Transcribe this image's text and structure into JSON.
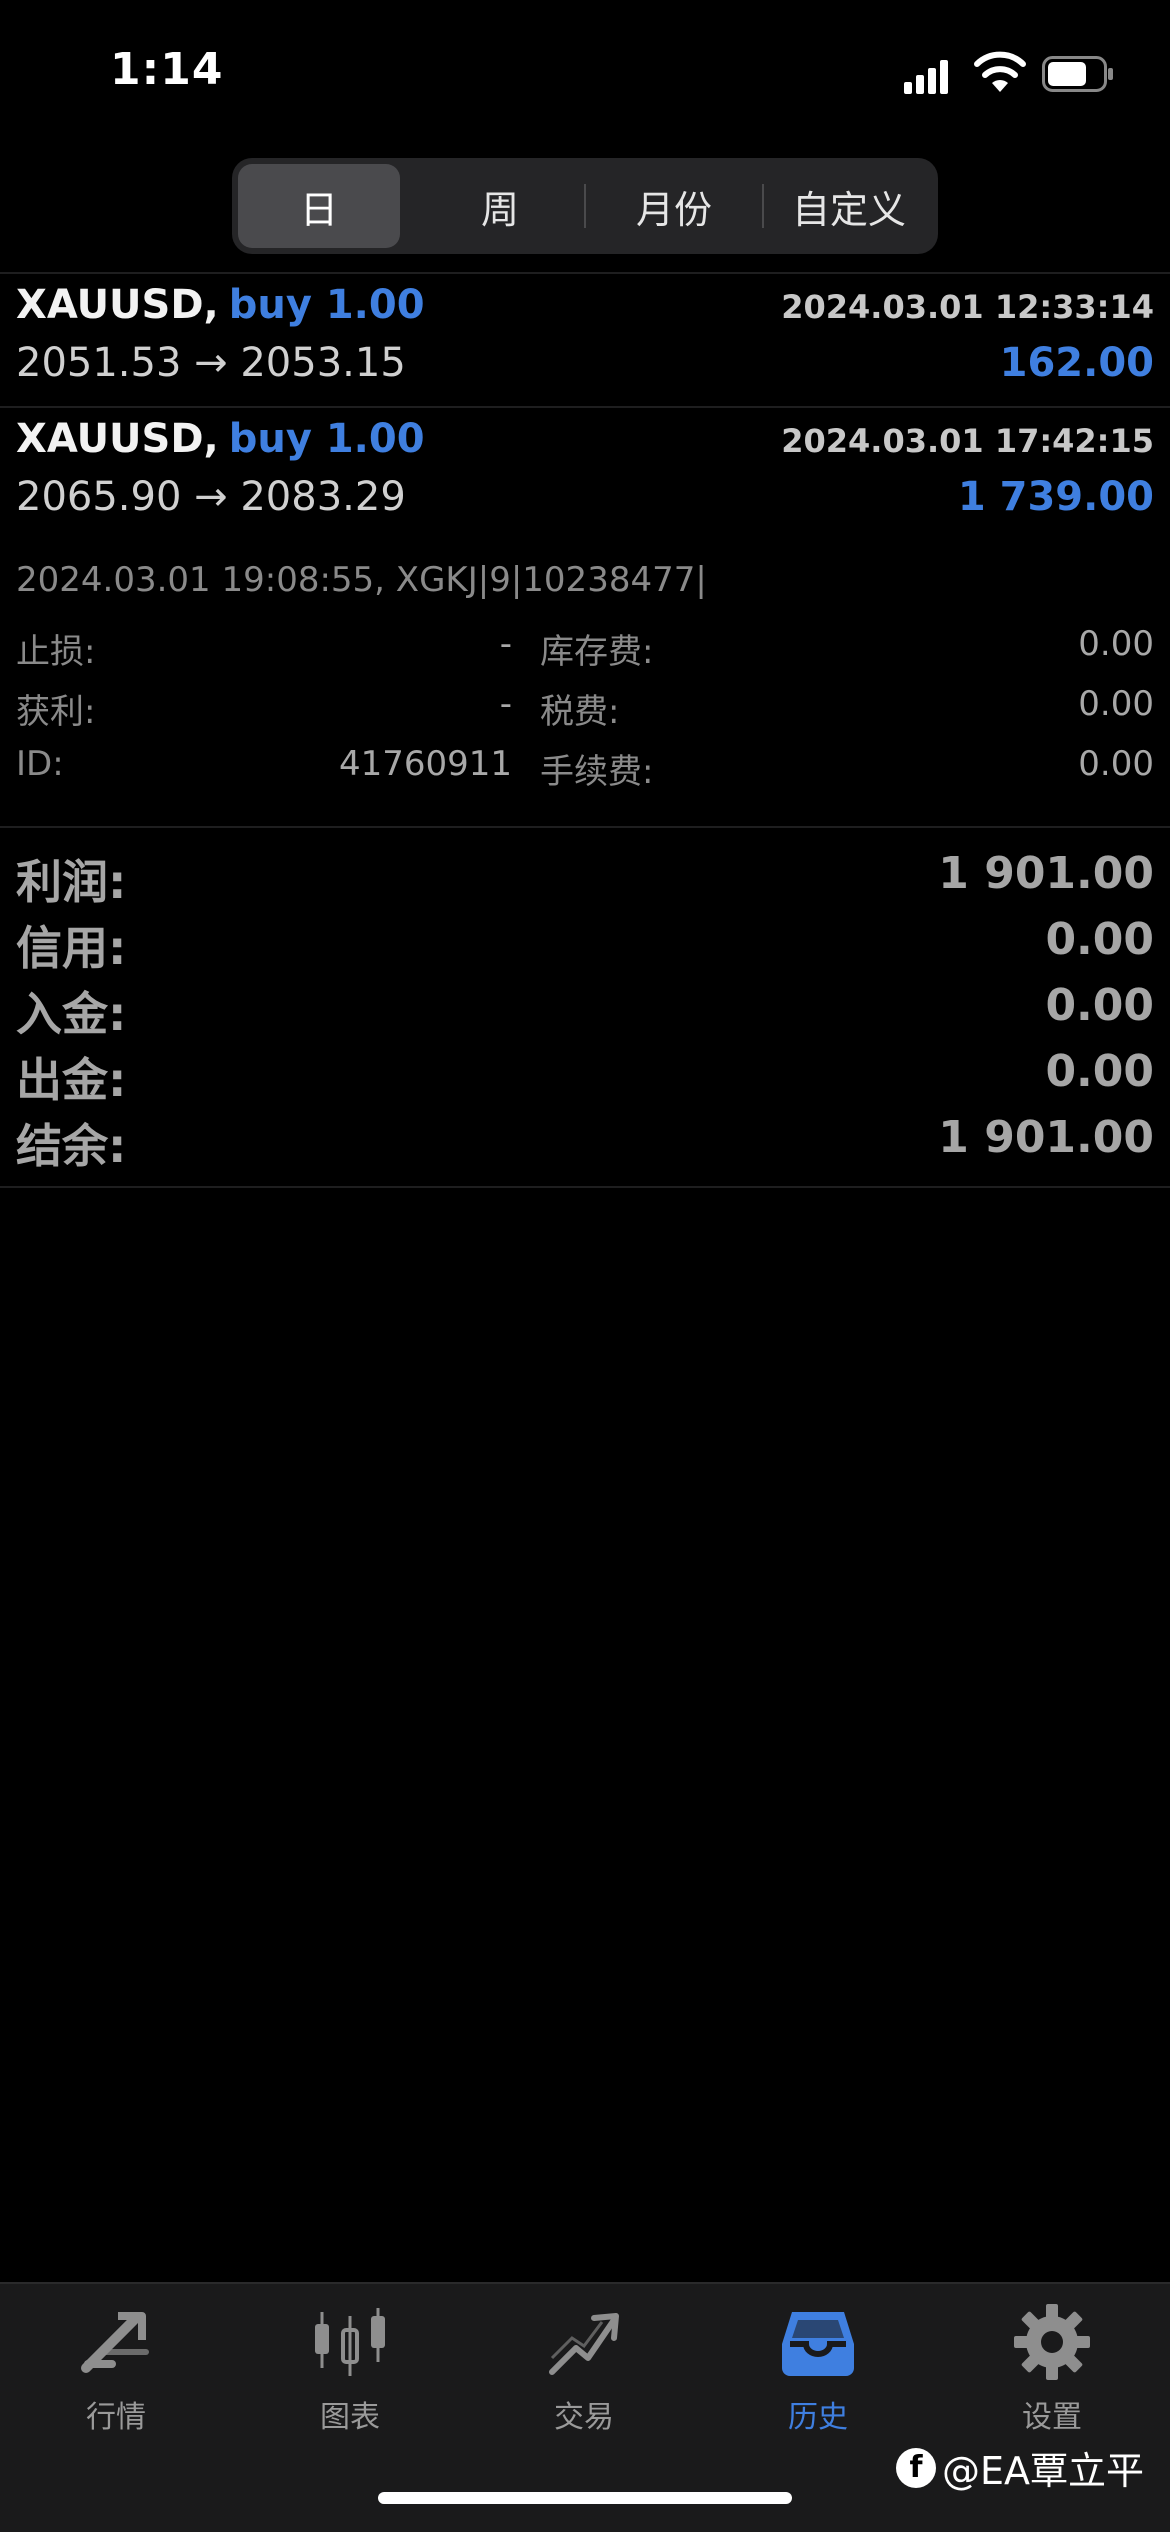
{
  "status": {
    "time": "1:14"
  },
  "periods": {
    "day": "日",
    "week": "周",
    "month": "月份",
    "custom": "自定义",
    "selected": "日"
  },
  "deals": [
    {
      "symbol": "XAUUSD,",
      "direction": "buy 1.00",
      "datetime": "2024.03.01 12:33:14",
      "prices": "2051.53 → 2053.15",
      "profit": "162.00"
    },
    {
      "symbol": "XAUUSD,",
      "direction": "buy 1.00",
      "datetime": "2024.03.01 17:42:15",
      "prices": "2065.90 → 2083.29",
      "profit": "1 739.00"
    }
  ],
  "details": {
    "line": "2024.03.01 19:08:55, XGKJ|9|10238477|",
    "stop_loss_label": "止损:",
    "stop_loss": "-",
    "take_profit_label": "获利:",
    "take_profit": "-",
    "id_label": "ID:",
    "id": "41760911",
    "swap_label": "库存费:",
    "swap": "0.00",
    "tax_label": "税费:",
    "tax": "0.00",
    "commission_label": "手续费:",
    "commission": "0.00"
  },
  "summary": [
    {
      "label": "利润:",
      "value": "1 901.00"
    },
    {
      "label": "信用:",
      "value": "0.00"
    },
    {
      "label": "入金:",
      "value": "0.00"
    },
    {
      "label": "出金:",
      "value": "0.00"
    },
    {
      "label": "结余:",
      "value": "1 901.00"
    }
  ],
  "tabs": [
    {
      "label": "行情",
      "icon": "quotes-arrows-icon"
    },
    {
      "label": "图表",
      "icon": "candlestick-chart-icon"
    },
    {
      "label": "交易",
      "icon": "trade-trend-icon"
    },
    {
      "label": "历史",
      "icon": "history-inbox-icon"
    },
    {
      "label": "设置",
      "icon": "gear-icon"
    }
  ],
  "active_tab": "历史",
  "watermark": "@EA覃立平",
  "colors": {
    "accent": "#3f7fe0",
    "background": "#000000",
    "muted": "#8a8a8a"
  }
}
